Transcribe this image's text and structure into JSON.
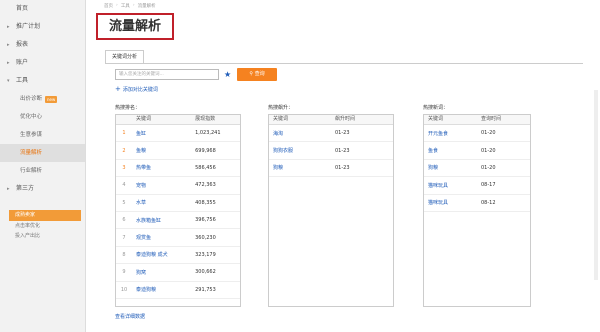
{
  "sidebar": {
    "items": [
      {
        "label": "首页",
        "arrow": ""
      },
      {
        "label": "推广计划",
        "arrow": "▸"
      },
      {
        "label": "报表",
        "arrow": "▸"
      },
      {
        "label": "账户",
        "arrow": "▸"
      },
      {
        "label": "工具",
        "arrow": "▾"
      }
    ],
    "tools": [
      {
        "label": "出价诊断",
        "badge": "new"
      },
      {
        "label": "优化中心",
        "badge": ""
      },
      {
        "label": "生意参谋",
        "badge": ""
      },
      {
        "label": "流量解析",
        "badge": "",
        "active": true
      },
      {
        "label": "行业解析",
        "badge": ""
      }
    ],
    "third_party": {
      "label": "第三方",
      "arrow": "▸"
    },
    "box": {
      "header": "成熟卖家",
      "rows": [
        "点击率优化",
        "投入产出比"
      ]
    }
  },
  "breadcrumb": [
    "首页",
    "工具",
    "流量解析"
  ],
  "page_title": "流量解析",
  "tab": "关键词分析",
  "search": {
    "placeholder": "输入您关注的关键词...",
    "button": "查询",
    "add_link": "添加对比关键词"
  },
  "panels": {
    "p1": {
      "title": "热搜排名：",
      "headers": [
        "",
        "关键词",
        "展现指数"
      ],
      "rows": [
        {
          "rank": "1",
          "kw": "鱼缸",
          "val": "1,023,241"
        },
        {
          "rank": "2",
          "kw": "鱼粮",
          "val": "699,968"
        },
        {
          "rank": "3",
          "kw": "热带鱼",
          "val": "586,456"
        },
        {
          "rank": "4",
          "kw": "宠物",
          "val": "472,363"
        },
        {
          "rank": "5",
          "kw": "水草",
          "val": "408,355"
        },
        {
          "rank": "6",
          "kw": "水族箱鱼缸",
          "val": "396,756"
        },
        {
          "rank": "7",
          "kw": "观赏鱼",
          "val": "360,230"
        },
        {
          "rank": "8",
          "kw": "泰迪狗粮 成犬",
          "val": "323,179"
        },
        {
          "rank": "9",
          "kw": "狗窝",
          "val": "300,662"
        },
        {
          "rank": "10",
          "kw": "泰迪狗粮",
          "val": "291,753"
        }
      ]
    },
    "p2": {
      "title": "热搜飙升：",
      "headers": [
        "关键词",
        "飙升时间"
      ],
      "rows": [
        {
          "kw": "海淘",
          "time": "01-23"
        },
        {
          "kw": "狗狗衣服",
          "time": "01-23"
        },
        {
          "kw": "狗粮",
          "time": "01-23"
        }
      ]
    },
    "p3": {
      "title": "热搜新词：",
      "headers": [
        "关键词",
        "查询时间"
      ],
      "rows": [
        {
          "kw": "开元鱼食",
          "time": "01-20"
        },
        {
          "kw": "鱼食",
          "time": "01-20"
        },
        {
          "kw": "狗粮",
          "time": "01-20"
        },
        {
          "kw": "猫咪玩具",
          "time": "08-17"
        },
        {
          "kw": "猫咪玩具",
          "time": "08-12"
        }
      ]
    }
  },
  "bottom_link": "查看详细数据"
}
